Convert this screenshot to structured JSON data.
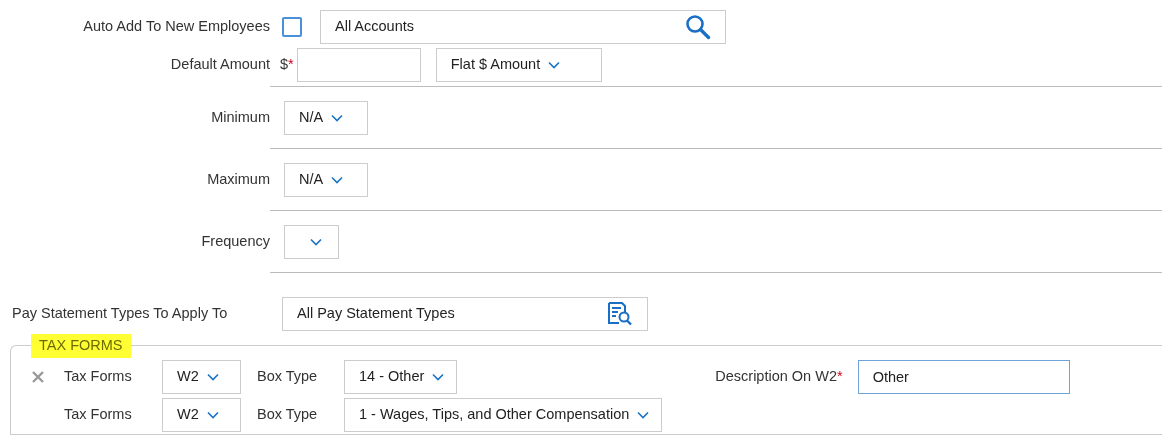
{
  "fields": [
    {
      "kind": "checkbox-search",
      "label": "Auto Add To New Employees",
      "checked": false,
      "value": "All Accounts"
    },
    {
      "kind": "amount",
      "label": "Default Amount",
      "prefix": "$",
      "required_mark": "*",
      "dropdown": "Flat $ Amount"
    },
    {
      "kind": "select",
      "label": "Minimum",
      "value": "N/A"
    },
    {
      "kind": "select",
      "label": "Maximum",
      "value": "N/A"
    },
    {
      "kind": "select",
      "label": "Frequency"
    },
    {
      "kind": "lookup",
      "label": "Pay Statement Types To Apply To",
      "value": "All Pay Statement Types"
    }
  ],
  "tax_forms": {
    "legend": "TAX FORMS",
    "rows": [
      {
        "removable": true,
        "form_label": "Tax Forms",
        "form": "W2",
        "box_label": "Box Type",
        "box": "14 - Other",
        "description_label": "Description On W2",
        "required_mark": "*",
        "description": "Other"
      },
      {
        "removable": false,
        "form_label": "Tax Forms",
        "form": "W2",
        "box_label": "Box Type",
        "box": "1 - Wages, Tips, and Other Compensation"
      }
    ]
  }
}
